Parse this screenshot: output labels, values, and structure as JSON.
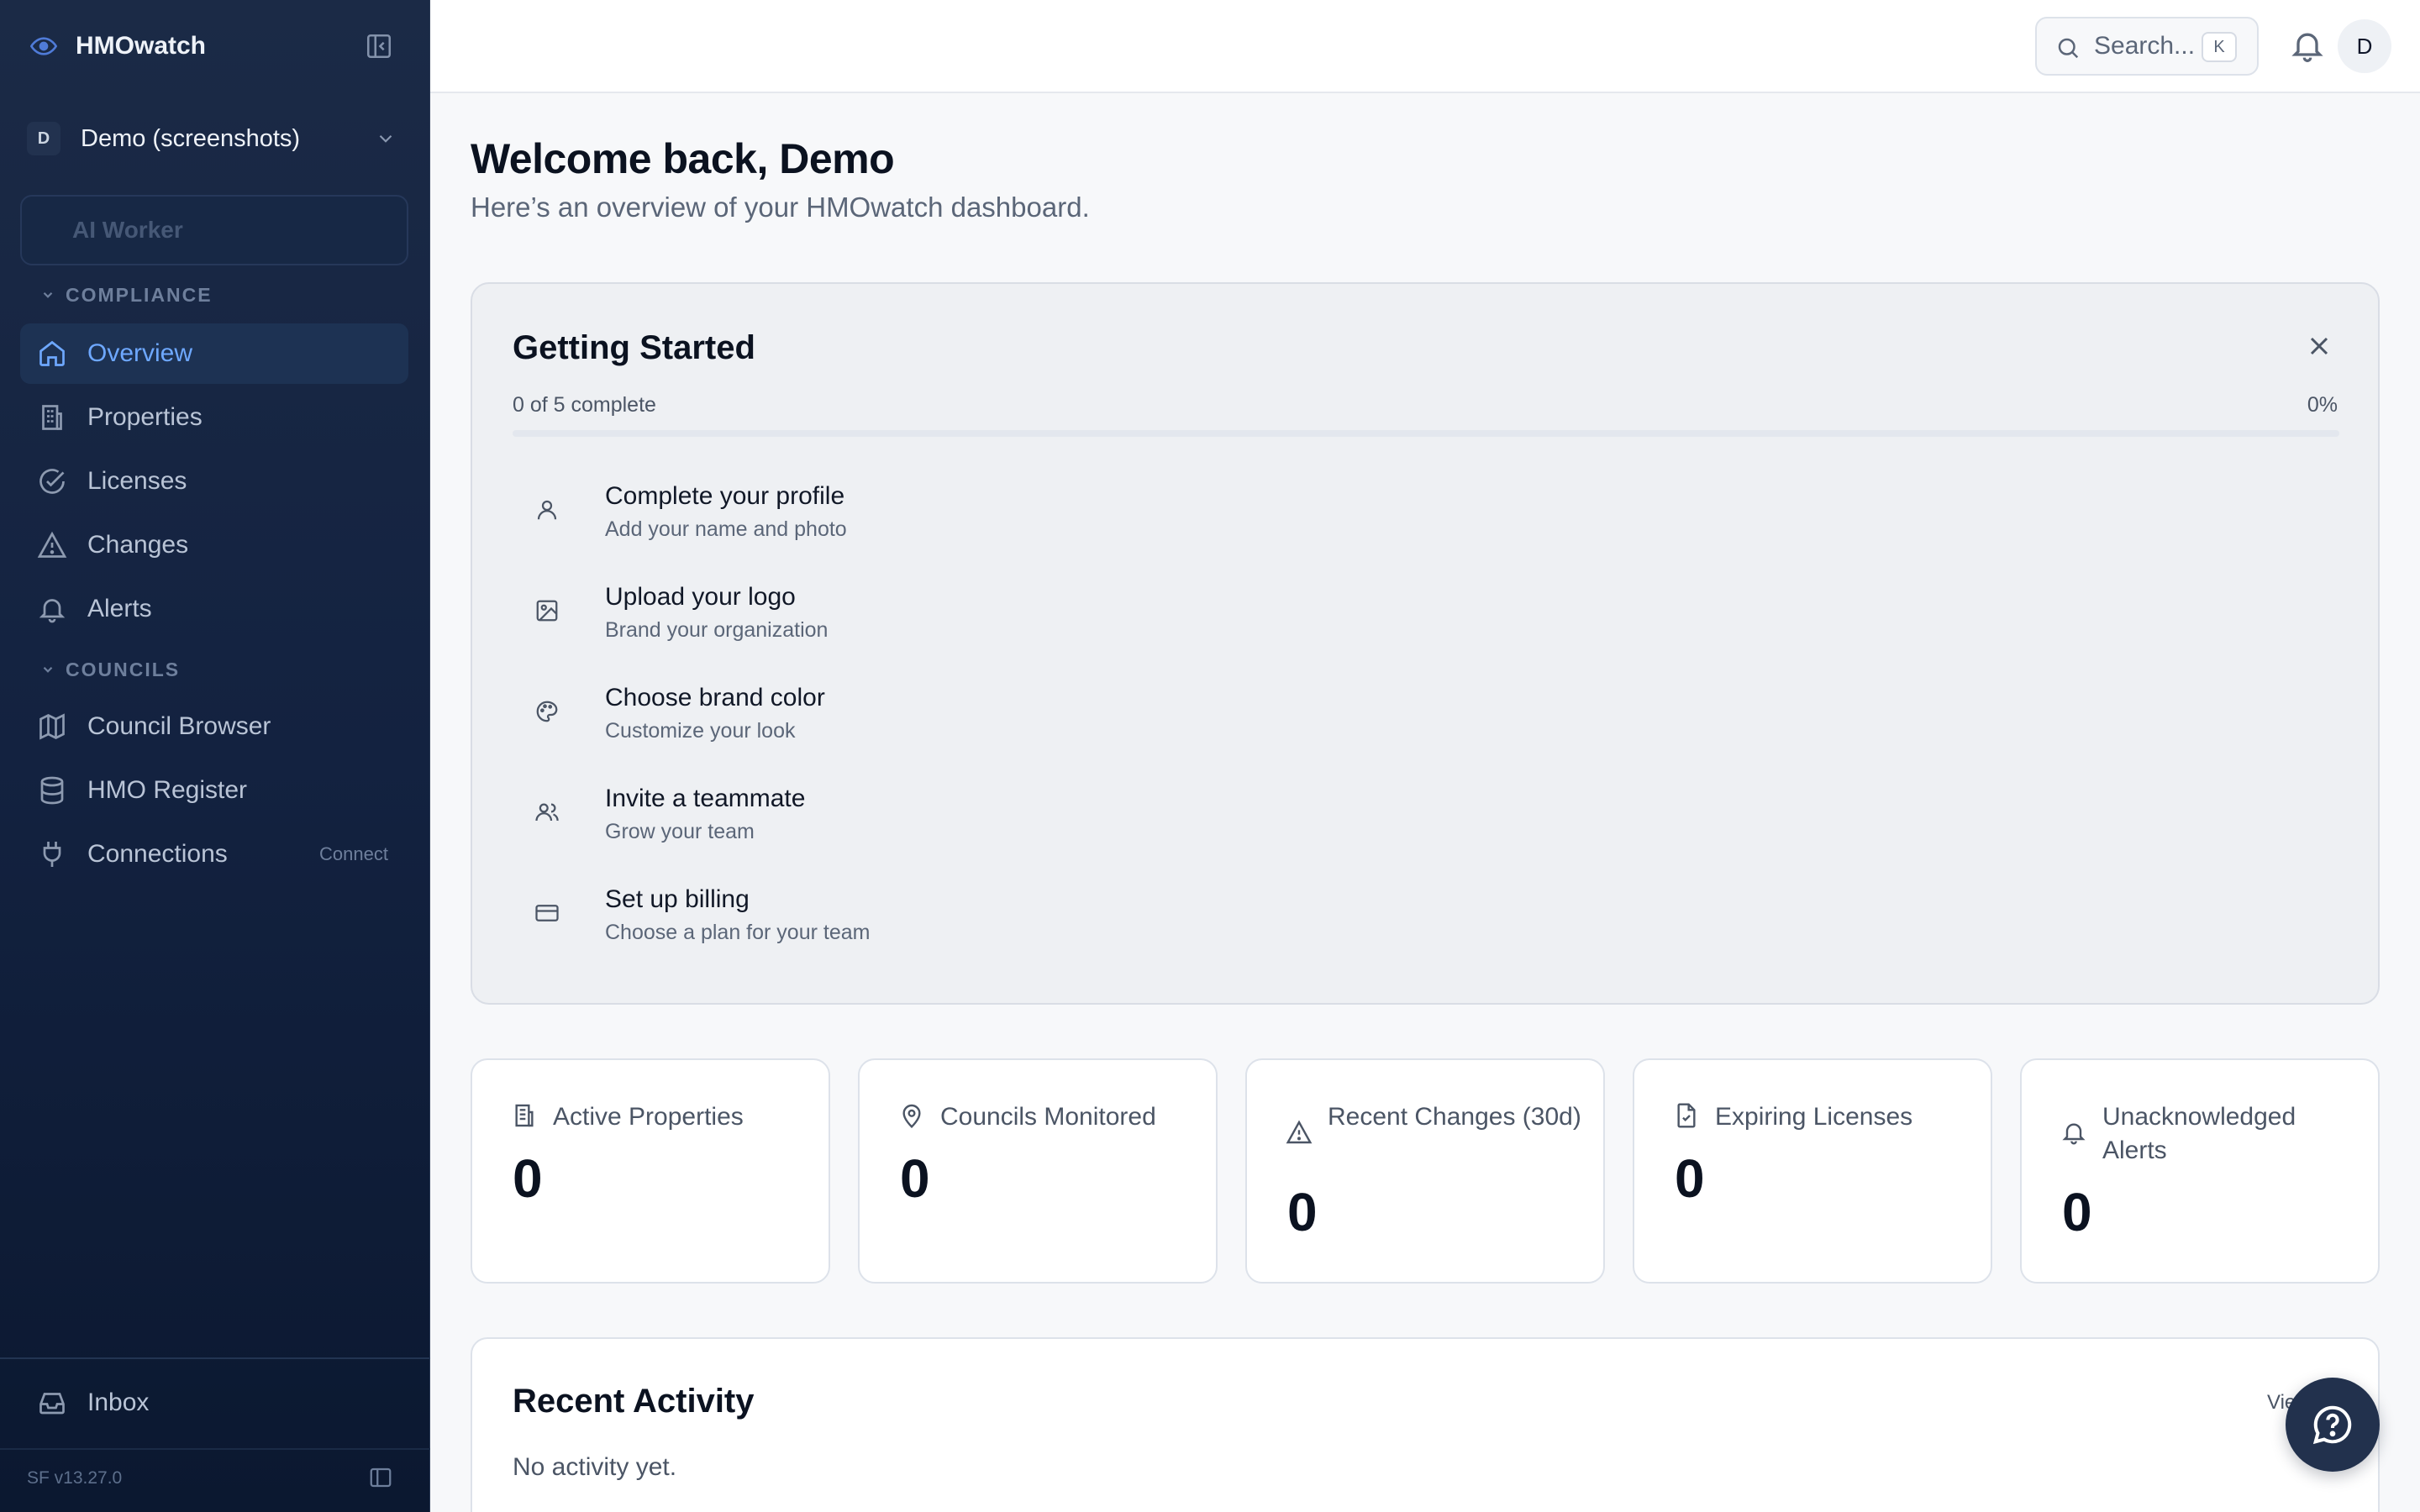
{
  "app": {
    "name": "HMOwatch",
    "version": "SF v13.27.0"
  },
  "org": {
    "initial": "D",
    "name": "Demo (screenshots)"
  },
  "sidebar": {
    "ai_worker_label": "AI Worker",
    "sections": [
      {
        "title": "COMPLIANCE",
        "items": [
          {
            "label": "Overview",
            "icon": "home-icon",
            "active": true
          },
          {
            "label": "Properties",
            "icon": "building-icon"
          },
          {
            "label": "Licenses",
            "icon": "check-circle-icon"
          },
          {
            "label": "Changes",
            "icon": "warning-icon"
          },
          {
            "label": "Alerts",
            "icon": "bell-icon"
          }
        ]
      },
      {
        "title": "COUNCILS",
        "items": [
          {
            "label": "Council Browser",
            "icon": "map-icon"
          },
          {
            "label": "HMO Register",
            "icon": "database-icon"
          },
          {
            "label": "Connections",
            "icon": "plug-icon",
            "action": "Connect"
          }
        ]
      }
    ],
    "inbox_label": "Inbox"
  },
  "topbar": {
    "search_placeholder": "Search...",
    "search_shortcut": "K",
    "avatar_initial": "D"
  },
  "main": {
    "welcome": "Welcome back, Demo",
    "subtitle": "Here’s an overview of your HMOwatch dashboard.",
    "getting_started": {
      "title": "Getting Started",
      "progress_text": "0 of 5 complete",
      "progress_percent_text": "0%",
      "progress_fraction": 0,
      "tasks": [
        {
          "title": "Complete your profile",
          "subtitle": "Add your name and photo",
          "icon": "user-icon"
        },
        {
          "title": "Upload your logo",
          "subtitle": "Brand your organization",
          "icon": "image-icon"
        },
        {
          "title": "Choose brand color",
          "subtitle": "Customize your look",
          "icon": "palette-icon"
        },
        {
          "title": "Invite a teammate",
          "subtitle": "Grow your team",
          "icon": "users-icon"
        },
        {
          "title": "Set up billing",
          "subtitle": "Choose a plan for your team",
          "icon": "credit-card-icon"
        }
      ]
    },
    "stats": [
      {
        "label": "Active Properties",
        "value": "0",
        "icon": "building-icon"
      },
      {
        "label": "Councils Monitored",
        "value": "0",
        "icon": "map-pin-icon"
      },
      {
        "label": "Recent Changes (30d)",
        "value": "0",
        "icon": "warning-icon"
      },
      {
        "label": "Expiring Licenses",
        "value": "0",
        "icon": "file-check-icon"
      },
      {
        "label": "Unacknowledged Alerts",
        "value": "0",
        "icon": "bell-icon"
      }
    ],
    "recent_activity": {
      "title": "Recent Activity",
      "view_all": "View all",
      "empty": "No activity yet."
    }
  },
  "colors": {
    "accent": "#3b82f6",
    "active_nav_text": "#6ea8ff",
    "sidebar_bg": "#132240"
  }
}
